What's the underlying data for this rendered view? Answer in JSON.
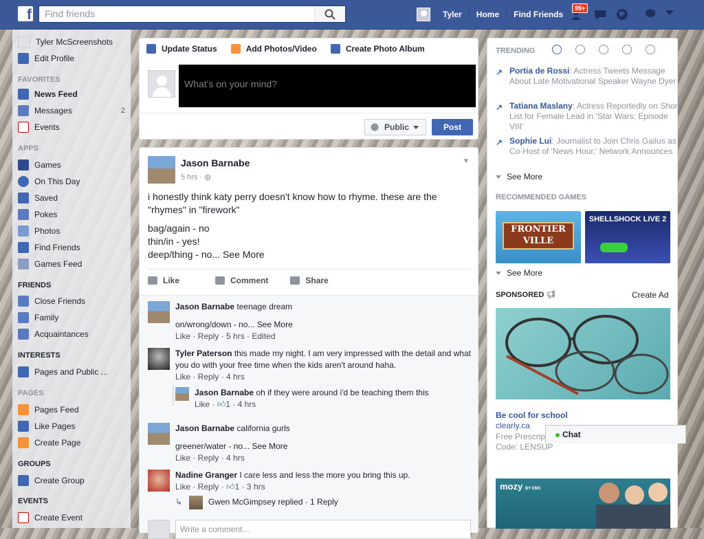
{
  "header": {
    "logo": "f",
    "search_placeholder": "Find friends",
    "user_name": "Tyler",
    "home_label": "Home",
    "find_friends_label": "Find Friends",
    "notification_badge": "99+",
    "brand_color": "#3b5998"
  },
  "sidebar": {
    "profile_name": "Tyler McScreenshots",
    "edit_profile": "Edit Profile",
    "favorites_head": "FAVORITES",
    "favorites": [
      {
        "label": "News Feed",
        "icon": "news-feed-icon"
      },
      {
        "label": "Messages",
        "icon": "messages-icon",
        "count": "2"
      },
      {
        "label": "Events",
        "icon": "events-icon"
      }
    ],
    "apps_head": "APPS",
    "apps": [
      {
        "label": "Games",
        "icon": "games-icon"
      },
      {
        "label": "On This Day",
        "icon": "on-this-day-icon"
      },
      {
        "label": "Saved",
        "icon": "saved-icon"
      },
      {
        "label": "Pokes",
        "icon": "pokes-icon"
      },
      {
        "label": "Photos",
        "icon": "photos-icon"
      },
      {
        "label": "Find Friends",
        "icon": "find-friends-icon"
      },
      {
        "label": "Games Feed",
        "icon": "games-feed-icon"
      }
    ],
    "friends_head": "FRIENDS",
    "friends": [
      {
        "label": "Close Friends",
        "icon": "close-friends-icon"
      },
      {
        "label": "Family",
        "icon": "family-icon"
      },
      {
        "label": "Acquaintances",
        "icon": "acquaintances-icon"
      }
    ],
    "interests_head": "INTERESTS",
    "interests": [
      {
        "label": "Pages and Public ...",
        "icon": "pages-public-icon"
      }
    ],
    "pages_head": "PAGES",
    "pages": [
      {
        "label": "Pages Feed",
        "icon": "pages-feed-icon"
      },
      {
        "label": "Like Pages",
        "icon": "like-pages-icon"
      },
      {
        "label": "Create Page",
        "icon": "create-page-icon"
      }
    ],
    "groups_head": "GROUPS",
    "groups": [
      {
        "label": "Create Group",
        "icon": "create-group-icon"
      }
    ],
    "events_head": "EVENTS",
    "events": [
      {
        "label": "Create Event",
        "icon": "create-event-icon"
      }
    ]
  },
  "composer": {
    "tabs": [
      "Update Status",
      "Add Photos/Video",
      "Create Photo Album"
    ],
    "placeholder": "What's on your mind?",
    "audience": "Public",
    "post_label": "Post"
  },
  "post": {
    "author": "Jason Barnabe",
    "time": "5 hrs",
    "line1": "i honestly think katy perry doesn't know how to rhyme. these are the \"rhymes\" in \"firework\"",
    "line2": "bag/again - no",
    "line3": "thin/in - yes!",
    "line4": "deep/thing - no...",
    "see_more": "See More",
    "actions": [
      "Like",
      "Comment",
      "Share"
    ]
  },
  "comments": [
    {
      "name": "Jason Barnabe",
      "text": "teenage dream",
      "line2": "on/wrong/down - no...",
      "see_more": "See More",
      "links": "Like · Reply · 5 hrs · Edited"
    },
    {
      "name": "Tyler Paterson",
      "text": "this made my night. I am very impressed with the detail and what you do with your free time when the kids aren't around haha.",
      "links": "Like · Reply · 4 hrs"
    },
    {
      "name": "Jason Barnabe",
      "text": "oh if they were around i'd be teaching them this",
      "links_prefix": "Like · ",
      "likes": "1",
      "links_suffix": " · 4 hrs"
    },
    {
      "name": "Jason Barnabe",
      "text": "california gurls",
      "line2": "greener/water - no...",
      "see_more": "See More",
      "links": "Like · Reply · 4 hrs"
    },
    {
      "name": "Nadine Granger",
      "text": "I care less and less the more you bring this up.",
      "links_prefix": "Like · Reply · ",
      "likes": "1",
      "links_suffix": " · 3 hrs"
    }
  ],
  "reply_summary": "Gwen McGimpsey replied · 1 Reply",
  "write_comment": "Write a comment...",
  "right": {
    "trending_head": "TRENDING",
    "trends": [
      {
        "name": "Portia de Rossi",
        "text": ": Actress Tweets Message About Late Motivational Speaker Wayne Dyer"
      },
      {
        "name": "Tatiana Maslany",
        "text": ": Actress Reportedly on Short List for Female Lead in 'Star Wars: Episode VIII'"
      },
      {
        "name": "Sophie Lui",
        "text": ": Journalist to Join Chris Gailus as Co-Host of 'News Hour,' Network Announces"
      }
    ],
    "see_more": "See More",
    "games_head": "RECOMMENDED GAMES",
    "game1": "FRONTIER VILLE",
    "game2": "SHELLSHOCK LIVE 2",
    "games_see_more": "See More",
    "sponsored": "SPONSORED",
    "create_ad": "Create Ad",
    "ad_title": "Be cool for school",
    "ad_url": "clearly.ca",
    "ad_desc": "Free Prescription Lenses at Clearly - Use Code: LENSUP",
    "ad2_brand": "mozy",
    "ad2_sub": "BY EMC"
  },
  "chat": {
    "label": "Chat"
  }
}
